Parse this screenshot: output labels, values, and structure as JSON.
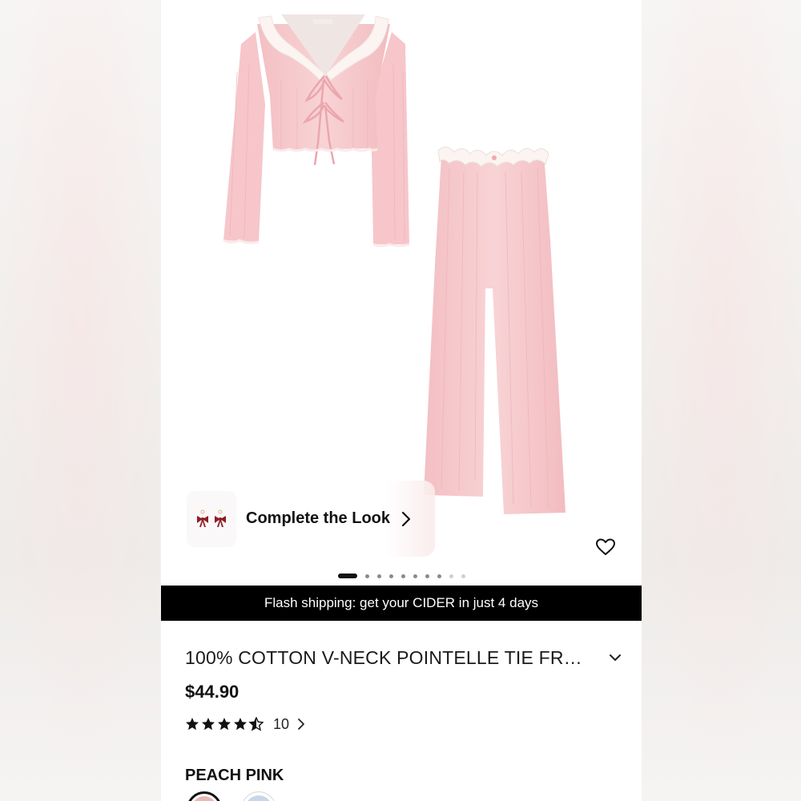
{
  "gallery": {
    "complete_look_label": "Complete the Look",
    "slide_count": 10,
    "active_slide": 1
  },
  "banner": {
    "text": "Flash shipping: get your CIDER in just 4 days"
  },
  "product": {
    "title": "100% COTTON V-NECK POINTELLE TIE FR…",
    "price": "$44.90",
    "rating": 4.5,
    "rating_count": "10",
    "color_name": "PEACH PINK",
    "swatches": [
      {
        "name": "peach-pink",
        "color": "#e8b9b4",
        "selected": true
      },
      {
        "name": "light-blue",
        "color": "#c9d6ea",
        "selected": false
      }
    ]
  },
  "colors": {
    "garment_pink": "#f6c9cc",
    "banner_bg": "#000000",
    "text": "#111111"
  }
}
